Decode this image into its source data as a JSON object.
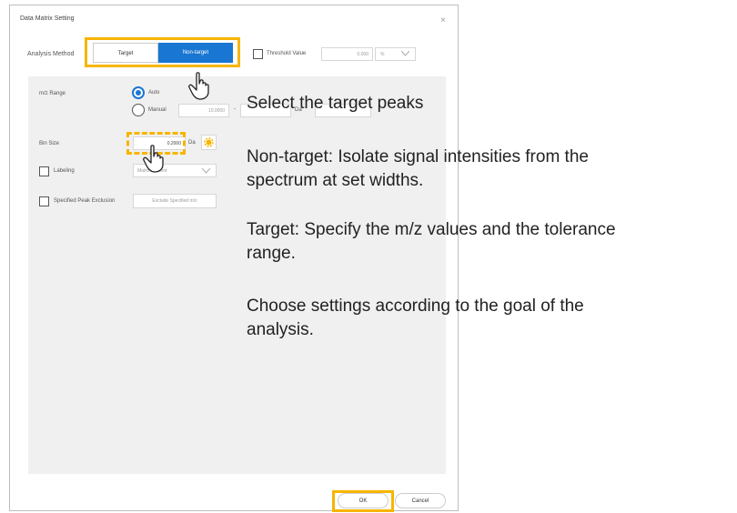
{
  "dialog": {
    "title": "Data Matrix Setting",
    "close_glyph": "×"
  },
  "analysis_method": {
    "label": "Analysis Method",
    "options": [
      "Target",
      "Non-target"
    ],
    "selected": "Non-target"
  },
  "threshold": {
    "label": "Threshold Value",
    "value": "0.000",
    "unit": "%"
  },
  "mz_range": {
    "label": "m/z Range",
    "auto_label": "Auto",
    "manual_label": "Manual",
    "selected": "Auto",
    "from_value": "10.0000",
    "separator": "-",
    "to_unit": "Da"
  },
  "bin_size": {
    "label": "Bin Size",
    "value": "0.2000",
    "unit": "Da"
  },
  "labeling": {
    "label": "Labeling",
    "checked": false,
    "select_value": "Matrix Content"
  },
  "peak_exclusion": {
    "label": "Specified Peak Exclusion",
    "checked": false,
    "button_label": "Exclude Specified m/z"
  },
  "footer": {
    "ok_label": "OK",
    "cancel_label": "Cancel"
  },
  "annotations": {
    "line1": "Select the target peaks",
    "para2_line1": "Non-target: Isolate signal intensities from the",
    "para2_line2": "spectrum at set widths.",
    "para3_line1": "Target: Specify the m/z values and the tolerance",
    "para3_line2": "range.",
    "para4_line1": "Choose settings according to the goal of the",
    "para4_line2": "analysis."
  },
  "colors": {
    "accent_blue": "#1976d2",
    "highlight_orange": "#f7b500",
    "panel_gray": "#f0f0f0"
  },
  "icons": [
    "close-icon",
    "hand-pointer-icon",
    "gear-icon",
    "chevron-down-icon"
  ]
}
